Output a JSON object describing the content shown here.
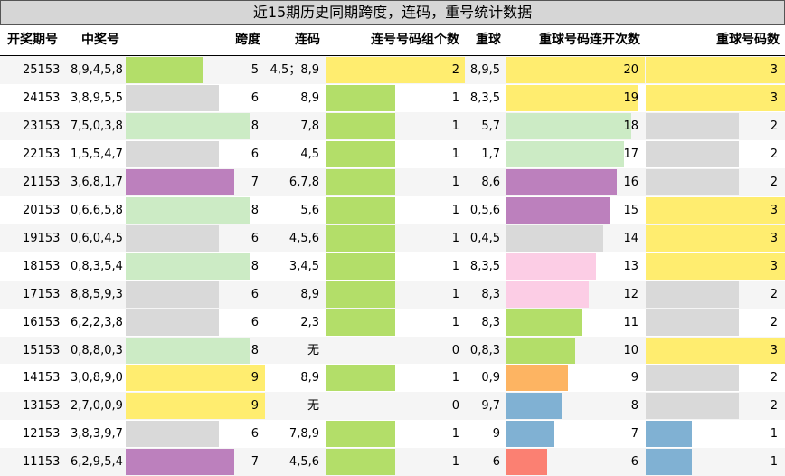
{
  "title": "近15期历史同期跨度，连码，重号统计数据",
  "headers": {
    "period": "开奖期号",
    "numbers": "中奖号",
    "span": "跨度",
    "consecutive": "连码",
    "consecutive_groups": "连号号码组个数",
    "repeat_balls": "重球",
    "repeat_streak": "重球号码连开次数",
    "repeat_count": "重球号码数"
  },
  "colors": {
    "green": "#b3de69",
    "light_green": "#ccebc5",
    "gray": "#d9d9d9",
    "purple": "#bc80bd",
    "yellow": "#ffed6f",
    "pink": "#fccde5",
    "orange": "#fdb462",
    "blue": "#80b1d3",
    "salmon": "#fb8072"
  },
  "rows": [
    {
      "period": "25153",
      "numbers": "8,9,4,5,8",
      "span": 5,
      "span_color": "green",
      "consec": "4,5；8,9",
      "groups": 2,
      "groups_color": "yellow",
      "repeat": "8,9,5",
      "streak": 20,
      "streak_color": "yellow",
      "count": 3,
      "count_color": "yellow"
    },
    {
      "period": "24153",
      "numbers": "3,8,9,5,5",
      "span": 6,
      "span_color": "gray",
      "consec": "8,9",
      "groups": 1,
      "groups_color": "green",
      "repeat": "8,3,5",
      "streak": 19,
      "streak_color": "yellow",
      "count": 3,
      "count_color": "yellow"
    },
    {
      "period": "23153",
      "numbers": "7,5,0,3,8",
      "span": 8,
      "span_color": "light_green",
      "consec": "7,8",
      "groups": 1,
      "groups_color": "green",
      "repeat": "5,7",
      "streak": 18,
      "streak_color": "light_green",
      "count": 2,
      "count_color": "gray"
    },
    {
      "period": "22153",
      "numbers": "1,5,5,4,7",
      "span": 6,
      "span_color": "gray",
      "consec": "4,5",
      "groups": 1,
      "groups_color": "green",
      "repeat": "1,7",
      "streak": 17,
      "streak_color": "light_green",
      "count": 2,
      "count_color": "gray"
    },
    {
      "period": "21153",
      "numbers": "3,6,8,1,7",
      "span": 7,
      "span_color": "purple",
      "consec": "6,7,8",
      "groups": 1,
      "groups_color": "green",
      "repeat": "8,6",
      "streak": 16,
      "streak_color": "purple",
      "count": 2,
      "count_color": "gray"
    },
    {
      "period": "20153",
      "numbers": "0,6,6,5,8",
      "span": 8,
      "span_color": "light_green",
      "consec": "5,6",
      "groups": 1,
      "groups_color": "green",
      "repeat": "0,5,6",
      "streak": 15,
      "streak_color": "purple",
      "count": 3,
      "count_color": "yellow"
    },
    {
      "period": "19153",
      "numbers": "0,6,0,4,5",
      "span": 6,
      "span_color": "gray",
      "consec": "4,5,6",
      "groups": 1,
      "groups_color": "green",
      "repeat": "0,4,5",
      "streak": 14,
      "streak_color": "gray",
      "count": 3,
      "count_color": "yellow"
    },
    {
      "period": "18153",
      "numbers": "0,8,3,5,4",
      "span": 8,
      "span_color": "light_green",
      "consec": "3,4,5",
      "groups": 1,
      "groups_color": "green",
      "repeat": "8,3,5",
      "streak": 13,
      "streak_color": "pink",
      "count": 3,
      "count_color": "yellow"
    },
    {
      "period": "17153",
      "numbers": "8,8,5,9,3",
      "span": 6,
      "span_color": "gray",
      "consec": "8,9",
      "groups": 1,
      "groups_color": "green",
      "repeat": "8,3",
      "streak": 12,
      "streak_color": "pink",
      "count": 2,
      "count_color": "gray"
    },
    {
      "period": "16153",
      "numbers": "6,2,2,3,8",
      "span": 6,
      "span_color": "gray",
      "consec": "2,3",
      "groups": 1,
      "groups_color": "green",
      "repeat": "8,3",
      "streak": 11,
      "streak_color": "green",
      "count": 2,
      "count_color": "gray"
    },
    {
      "period": "15153",
      "numbers": "0,8,8,0,3",
      "span": 8,
      "span_color": "light_green",
      "consec": "无",
      "groups": 0,
      "groups_color": "none",
      "repeat": "0,8,3",
      "streak": 10,
      "streak_color": "green",
      "count": 3,
      "count_color": "yellow"
    },
    {
      "period": "14153",
      "numbers": "3,0,8,9,0",
      "span": 9,
      "span_color": "yellow",
      "consec": "8,9",
      "groups": 1,
      "groups_color": "green",
      "repeat": "0,9",
      "streak": 9,
      "streak_color": "orange",
      "count": 2,
      "count_color": "gray"
    },
    {
      "period": "13153",
      "numbers": "2,7,0,0,9",
      "span": 9,
      "span_color": "yellow",
      "consec": "无",
      "groups": 0,
      "groups_color": "none",
      "repeat": "9,7",
      "streak": 8,
      "streak_color": "blue",
      "count": 2,
      "count_color": "gray"
    },
    {
      "period": "12153",
      "numbers": "3,8,3,9,7",
      "span": 6,
      "span_color": "gray",
      "consec": "7,8,9",
      "groups": 1,
      "groups_color": "green",
      "repeat": "9",
      "streak": 7,
      "streak_color": "blue",
      "count": 1,
      "count_color": "blue"
    },
    {
      "period": "11153",
      "numbers": "6,2,9,5,4",
      "span": 7,
      "span_color": "purple",
      "consec": "4,5,6",
      "groups": 1,
      "groups_color": "green",
      "repeat": "6",
      "streak": 6,
      "streak_color": "salmon",
      "count": 1,
      "count_color": "blue"
    }
  ]
}
